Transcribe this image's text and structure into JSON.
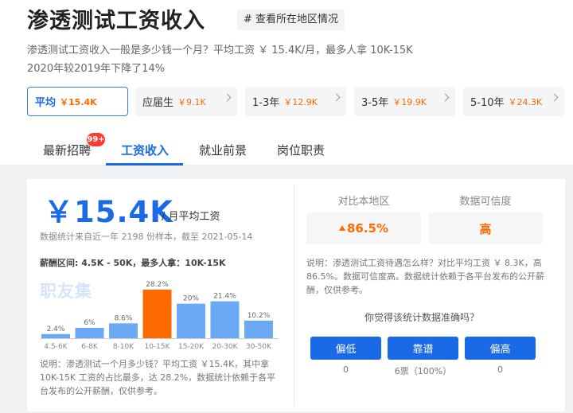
{
  "header": {
    "title": "渗透测试工资收入",
    "location_button": "# 查看所在地区情况",
    "desc_line1": "渗透测试工资收入一般是多少钱一个月？平均工资 ￥ 15.4K/月，最多人拿 10K-15K",
    "desc_line2": "2020年较2019年下降了14%"
  },
  "experience_tabs": [
    {
      "label": "平均",
      "value": "￥15.4K",
      "active": true
    },
    {
      "label": "应届生",
      "value": "￥9.1K",
      "active": false
    },
    {
      "label": "1-3年",
      "value": "￥12.9K",
      "active": false
    },
    {
      "label": "3-5年",
      "value": "￥19.9K",
      "active": false
    },
    {
      "label": "5-10年",
      "value": "￥24.3K",
      "active": false
    }
  ],
  "nav": {
    "items": [
      "最新招聘",
      "工资收入",
      "就业前景",
      "岗位职责"
    ],
    "active_index": 1,
    "badge": "99+"
  },
  "salary": {
    "amount": "￥15.4K",
    "unit": "/ 月平均工资",
    "stat_note": "数据统计来自近一年 2198 份样本，截至 2021-05-14",
    "range_line": "薪酬区间: 4.5K - 50K，最多人拿：10K-15K",
    "watermark": "职友集",
    "explain": "说明：渗透测试一个月多少钱？平均工资 ￥15.4K，其中拿10K-15K 工资的占比最多，达 28.2%，数据统计依赖于各平台发布的公开薪酬，仅供参考。"
  },
  "chart_data": {
    "type": "bar",
    "categories": [
      "4.5-6K",
      "6-8K",
      "8-10K",
      "10-15K",
      "15-20K",
      "20-30K",
      "30-50K"
    ],
    "values": [
      2.4,
      6,
      8.6,
      28.2,
      20,
      21.4,
      10.2
    ],
    "value_labels": [
      "2.4%",
      "6%",
      "8.6%",
      "28.2%",
      "20%",
      "21.4%",
      "10.2%"
    ],
    "highlight_index": 3,
    "colors": {
      "normal": "#6aaaf5",
      "highlight": "#ff6a00"
    },
    "ylim": [
      0,
      30
    ]
  },
  "compare": {
    "local_label": "对比本地区",
    "local_value": "86.5%",
    "credibility_label": "数据可信度",
    "credibility_value": "高",
    "explain": "说明：渗透测试工资待遇怎么样？对比平均工资 ￥ 8.3K，高 86.5%。数据可信度高。数据统计依赖于各平台发布的公开薪酬，仅供参考。",
    "question": "你觉得该统计数据准确吗？",
    "votes": [
      {
        "label": "偏低",
        "count": "0"
      },
      {
        "label": "靠谱",
        "count": "6票（100%）"
      },
      {
        "label": "偏高",
        "count": "0"
      }
    ]
  },
  "colors": {
    "primary": "#1a6ae8",
    "accent": "#ff6a00",
    "badge": "#ff3b30"
  }
}
